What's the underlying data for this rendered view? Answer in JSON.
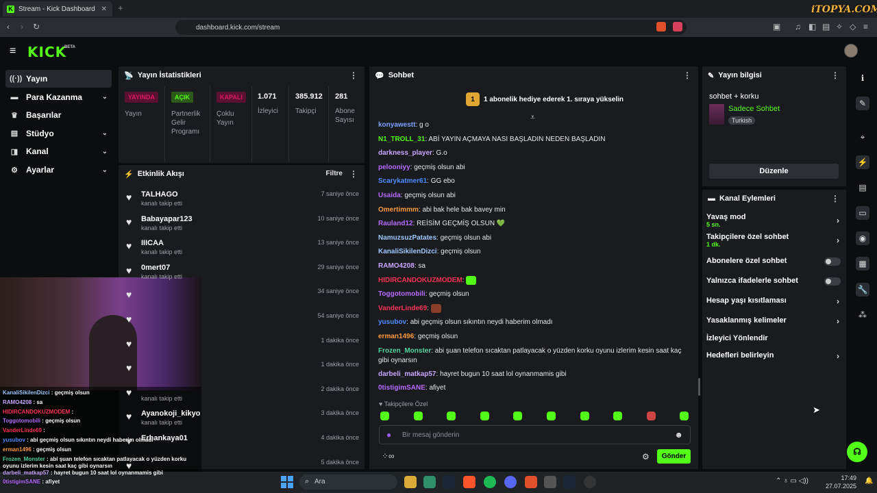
{
  "browser": {
    "tab_title": "Stream - Kick Dashboard",
    "url": "dashboard.kick.com/stream",
    "new_tab": "+",
    "close": "✕"
  },
  "watermark": "iTOPYA.COM",
  "header": {
    "logo": "KICK",
    "beta": "BETA"
  },
  "sidebar": {
    "items": [
      {
        "label": "Yayın",
        "icon": "broadcast-icon",
        "active": true
      },
      {
        "label": "Para Kazanma",
        "icon": "money-icon"
      },
      {
        "label": "Başarılar",
        "icon": "trophy-icon"
      },
      {
        "label": "Stüdyo",
        "icon": "studio-icon"
      },
      {
        "label": "Kanal",
        "icon": "channel-icon"
      },
      {
        "label": "Ayarlar",
        "icon": "gear-icon"
      }
    ]
  },
  "stats": {
    "title": "Yayın İstatistikleri",
    "badges": [
      {
        "badge": "YAYINDA",
        "label": "Yayın",
        "color": "#d9195e"
      },
      {
        "badge": "AÇIK",
        "label": "Partnerlik Gelir Programı",
        "color": "#53fc18"
      },
      {
        "badge": "KAPALI",
        "label": "Çoklu Yayın",
        "color": "#d9195e"
      }
    ],
    "numbers": [
      {
        "value": "1.071",
        "label": "İzleyici"
      },
      {
        "value": "385.912",
        "label": "Takipçi"
      },
      {
        "value": "281",
        "label": "Abone Sayısı"
      }
    ]
  },
  "activity": {
    "title": "Etkinlik Akışı",
    "filter": "Filtre",
    "events": [
      {
        "name": "TALHAGO",
        "sub": "kanalı takip etti",
        "time": "7 saniye önce"
      },
      {
        "name": "Babayapar123",
        "sub": "kanalı takip etti",
        "time": "10 saniye önce"
      },
      {
        "name": "IIICAA",
        "sub": "kanalı takip etti",
        "time": "13 saniye önce"
      },
      {
        "name": "0mert07",
        "sub": "kanalı takip etti",
        "time": "29 saniye önce"
      },
      {
        "name": "",
        "sub": "",
        "time": "34 saniye önce"
      },
      {
        "name": "",
        "sub": "",
        "time": "54 saniye önce"
      },
      {
        "name": "",
        "sub": "",
        "time": "1 dakika önce"
      },
      {
        "name": "",
        "sub": "",
        "time": "1 dakika önce"
      },
      {
        "name": "",
        "sub": "kanalı takip etti",
        "time": "2 dakika önce"
      },
      {
        "name": "Ayanokoji_kikyo",
        "sub": "kanalı takip etti",
        "time": "3 dakika önce"
      },
      {
        "name": "Erhankaya01",
        "sub": "",
        "time": "4 dakika önce"
      },
      {
        "name": "",
        "sub": "",
        "time": "5 dakika önce"
      }
    ]
  },
  "chat": {
    "title": "Sohbet",
    "banner_num": "1",
    "banner": "1 abonelik hediye ederek 1. sıraya yükselin",
    "messages": [
      {
        "user": "konyawestt",
        "text": "g o",
        "color": "#7fa0ff"
      },
      {
        "user": "N1_TROLL_31",
        "text": "ABİ YAYIN AÇMAYA NASI BAŞLADIN NEDEN BAŞLADIN",
        "color": "#53fc18"
      },
      {
        "user": "darkness_player",
        "text": "G.o",
        "color": "#c9a7ff"
      },
      {
        "user": "pelooniyy",
        "text": "geçmiş olsun abi",
        "color": "#b76cff"
      },
      {
        "user": "Scarykatmer61",
        "text": "GG ebo",
        "color": "#4e8cff"
      },
      {
        "user": "Usaida",
        "text": "geçmiş olsun abi",
        "color": "#b76cff"
      },
      {
        "user": "Omertimmm",
        "text": "abi bak hele bak bavey min",
        "color": "#ff9b3d"
      },
      {
        "user": "Rauland12",
        "text": "REİSİM GEÇMİŞ OLSUN 💚",
        "color": "#b76cff"
      },
      {
        "user": "NamuzsuzPatates",
        "text": "geçmiş olsun abi",
        "color": "#9ec8ff"
      },
      {
        "user": "KanaliSikilenDizci",
        "text": "geçmiş olsun",
        "color": "#9ec8ff"
      },
      {
        "user": "RAMO4208",
        "text": "sa",
        "color": "#c9a7ff"
      },
      {
        "user": "HIDIRCANDOKUZMODEM",
        "text": "[emote]",
        "color": "#ff3355"
      },
      {
        "user": "Toggotomobili",
        "text": "geçmiş olsun",
        "color": "#b76cff"
      },
      {
        "user": "VanderLinde69",
        "text": "[emote]",
        "color": "#ff3355"
      },
      {
        "user": "yusubov",
        "text": "abi geçmiş olsun sıkıntın neydi haberim olmadı",
        "color": "#4e8cff"
      },
      {
        "user": "erman1496",
        "text": "geçmiş olsun",
        "color": "#ff9b3d"
      },
      {
        "user": "Frozen_Monster",
        "text": "abi şuan telefon sıcaktan patlayacak o yüzden korku oyunu izlerim kesin saat kaç gibi oynarsın",
        "color": "#53d6a0"
      },
      {
        "user": "darbeli_matkap57",
        "text": "hayret bugun 10 saat lol oynanmamis gibi",
        "color": "#c9a7ff"
      },
      {
        "user": "0tistigimSANE",
        "text": "afiyet",
        "color": "#b76cff"
      }
    ],
    "followers_only": "Takipçilere Özel",
    "input_placeholder": "Bir mesaj gönderin",
    "send": "Gönder"
  },
  "info": {
    "title": "Yayın bilgisi",
    "stream_title": "sohbet + korku",
    "category": "Sadece Sohbet",
    "language": "Turkish",
    "edit": "Düzenle"
  },
  "actions": {
    "title": "Kanal Eylemleri",
    "items": [
      {
        "label": "Yavaş mod",
        "sub": "5 sn.",
        "kind": "chevron"
      },
      {
        "label": "Takipçilere özel sohbet",
        "sub": "1 dk.",
        "kind": "chevron"
      },
      {
        "label": "Abonelere özel sohbet",
        "sub": "",
        "kind": "toggle"
      },
      {
        "label": "Yalnızca ifadelerle sohbet",
        "sub": "",
        "kind": "toggle"
      },
      {
        "label": "Hesap yaşı kısıtlaması",
        "sub": "",
        "kind": "chevron"
      },
      {
        "label": "Yasaklanmış kelimeler",
        "sub": "",
        "kind": "chevron"
      },
      {
        "label": "İzleyici Yönlendir",
        "sub": "",
        "kind": "none"
      },
      {
        "label": "Hedefleri belirleyin",
        "sub": "",
        "kind": "chevron"
      }
    ]
  },
  "overlay_chat": [
    {
      "user": "KanaliSikilenDizci",
      "text": "geçmiş olsun",
      "color": "#9ec8ff"
    },
    {
      "user": "RAMO4208",
      "text": "sa",
      "color": "#c9a7ff"
    },
    {
      "user": "HIDIRCANDOKUZMODEM",
      "text": "",
      "color": "#ff3355"
    },
    {
      "user": "Toggotomobili",
      "text": "geçmiş olsun",
      "color": "#b76cff"
    },
    {
      "user": "VanderLinde69",
      "text": "",
      "color": "#ff3355"
    },
    {
      "user": "yusubov",
      "text": "abi geçmiş olsun sıkıntın neydi haberim olmadı",
      "color": "#4e8cff"
    },
    {
      "user": "erman1496",
      "text": "geçmiş olsun",
      "color": "#ff9b3d"
    },
    {
      "user": "Frozen_Monster",
      "text": "abi şuan telefon sıcaktan patlayacak o yüzden korku oyunu izlerim kesin saat kaç gibi oynarsın",
      "color": "#53d6a0"
    },
    {
      "user": "darbeli_matkap57",
      "text": "hayret bugun 10 saat lol oynanmamis gibi",
      "color": "#c9a7ff"
    },
    {
      "user": "0tistigimSANE",
      "text": "afiyet",
      "color": "#b76cff"
    }
  ],
  "taskbar": {
    "search": "Ara",
    "time": "17:49",
    "date": "27.07.2025"
  }
}
